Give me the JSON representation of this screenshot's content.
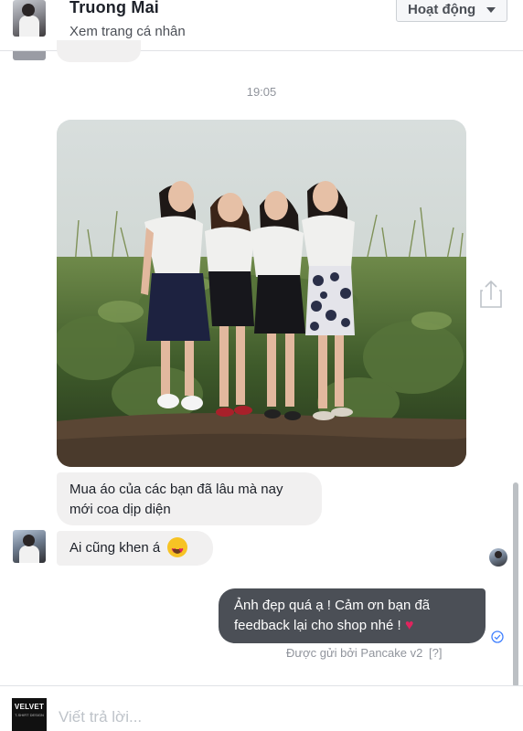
{
  "header": {
    "name": "Truong Mai",
    "profile_link": "Xem trang cá nhân",
    "status_button": "Hoạt động"
  },
  "conversation": {
    "timestamp": "19:05",
    "incoming": [
      {
        "text": "Mua áo của các bạn đã lâu mà nay mới coa dịp diện"
      },
      {
        "text": "Ai cũng khen á",
        "emoji": "heart-eyes-emoji"
      }
    ],
    "outgoing": {
      "text": "Ảnh đẹp quá ạ ! Cảm ơn bạn đã feedback lại cho shop nhé !",
      "emoji": "♥",
      "sent_by": "Được gửi bởi Pancake v2",
      "help": "[?]"
    }
  },
  "composer": {
    "placeholder": "Viết trả lời...",
    "page_logo": "VELVET",
    "page_logo_sub": "T-SHIRT DESIGN"
  },
  "colors": {
    "incoming_bubble": "#f1f0f0",
    "outgoing_bubble": "#4b4f56",
    "link_text": "#4b4f56",
    "meta_text": "#90949c"
  }
}
